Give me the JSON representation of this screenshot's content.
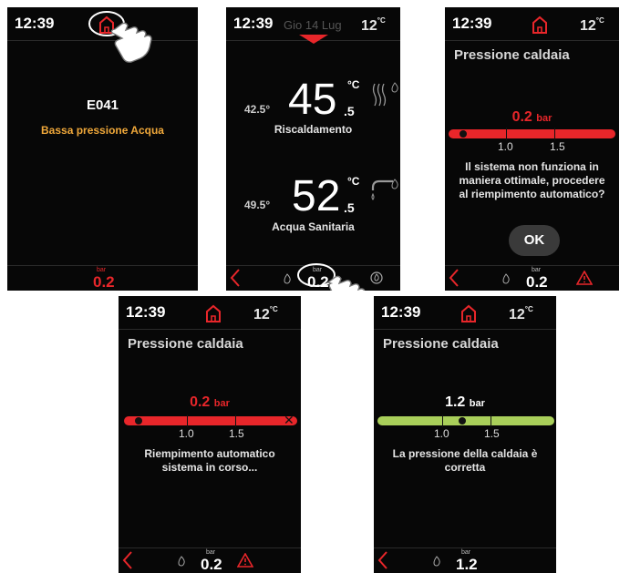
{
  "time": "12:39",
  "outdoor_temp": "12",
  "temp_unit": "°C",
  "screen1": {
    "error_code": "E041",
    "error_text": "Bassa pressione Acqua",
    "bar_unit": "bar",
    "bar_value": "0.2"
  },
  "screen2": {
    "date": "Gio 14 Lug",
    "heating": {
      "setpoint": "42.5°",
      "value": "45",
      "decimal": ".5",
      "unit": "°C",
      "label": "Riscaldamento"
    },
    "dhw": {
      "setpoint": "49.5°",
      "value": "52",
      "decimal": ".5",
      "unit": "°C",
      "label": "Acqua Sanitaria"
    },
    "bar_unit": "bar",
    "bar_value": "0.2"
  },
  "screen3": {
    "title": "Pressione caldaia",
    "pressure": "0.2",
    "pressure_unit": "bar",
    "ticks": [
      "1.0",
      "1.5"
    ],
    "message": [
      "Il sistema non funziona in",
      "maniera ottimale, procedere",
      "al riempimento automatico?"
    ],
    "ok_label": "OK",
    "bar_unit": "bar",
    "bar_value": "0.2"
  },
  "screen4": {
    "title": "Pressione caldaia",
    "pressure": "0.2",
    "pressure_unit": "bar",
    "ticks": [
      "1.0",
      "1.5"
    ],
    "message": [
      "Riempimento automatico",
      "sistema in corso..."
    ],
    "bar_unit": "bar",
    "bar_value": "0.2"
  },
  "screen5": {
    "title": "Pressione caldaia",
    "pressure": "1.2",
    "pressure_unit": "bar",
    "ticks": [
      "1.0",
      "1.5"
    ],
    "message": [
      "La pressione della caldaia è",
      "corretta"
    ],
    "bar_unit": "bar",
    "bar_value": "1.2"
  },
  "colors": {
    "alert_red": "#e8262a",
    "ok_green": "#a9cf5a",
    "warning_orange": "#f0a83a"
  }
}
